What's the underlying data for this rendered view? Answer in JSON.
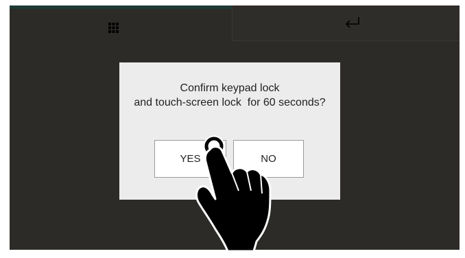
{
  "tabs": {
    "keypad_icon": "keypad-grid-icon",
    "back_icon": "return-arrow-icon"
  },
  "dialog": {
    "message": "Confirm keypad lock\nand touch-screen lock  for 60 seconds?",
    "yes_label": "YES",
    "no_label": "NO"
  },
  "overlay": {
    "hand_icon": "pointing-hand-icon"
  },
  "colors": {
    "screen_bg": "#2d2b27",
    "dialog_bg": "#ececec",
    "button_bg": "#ffffff",
    "accent_strip": "#1f3a37"
  }
}
